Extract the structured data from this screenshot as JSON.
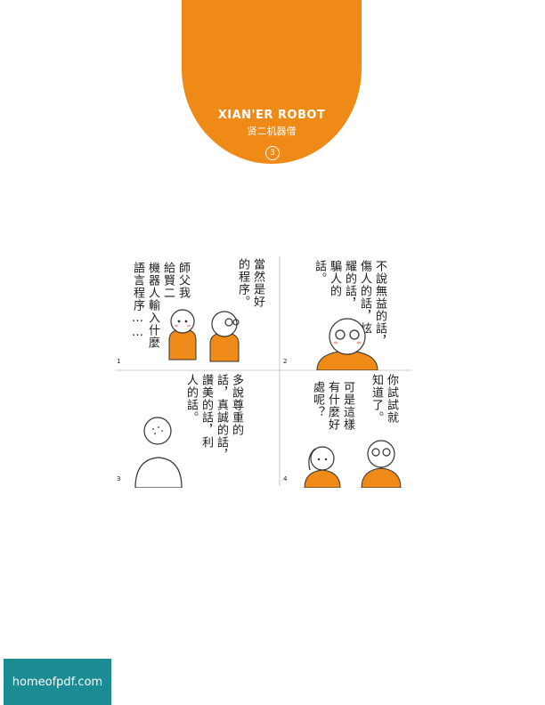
{
  "header": {
    "series_title": "XIAN'ER ROBOT",
    "series_subtitle": "贤二机器僧",
    "chapter_number": "3"
  },
  "comic": {
    "panels": [
      {
        "number": "1",
        "left_lines": [
          "師父我",
          "給賢二",
          "機器人輸入什麼",
          "語言程序……"
        ],
        "right_lines": [
          "當然是好",
          "的程序。"
        ]
      },
      {
        "number": "2",
        "lines": [
          "不說無益的話，",
          "傷人的話，炫",
          "耀的話，",
          "騙人的",
          "話。"
        ]
      },
      {
        "number": "3",
        "lines": [
          "多說尊重的",
          "話，真誠的話，",
          "讚美的話，利",
          "人的話。"
        ]
      },
      {
        "number": "4",
        "left_lines": [
          "可是這樣",
          "有什麼好",
          "處呢？"
        ],
        "right_lines": [
          "你試試就",
          "知道了。"
        ]
      }
    ]
  },
  "footer": {
    "watermark": "homeofpdf.com"
  }
}
